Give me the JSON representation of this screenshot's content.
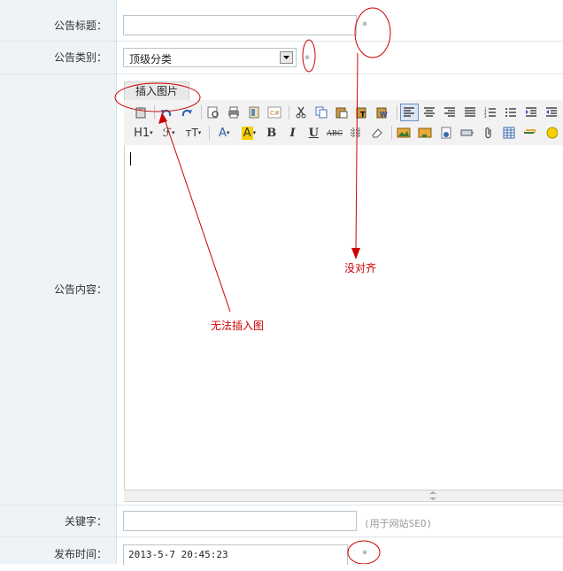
{
  "form": {
    "title_label": "公告标题：",
    "category_label": "公告类别：",
    "category_value": "顶级分类",
    "content_label": "公告内容：",
    "keywords_label": "关键字：",
    "keywords_hint": "(用于网站SEO)",
    "publish_label": "发布时间：",
    "publish_value": "2013-5-7 20:45:23",
    "required_mark": "*"
  },
  "editor": {
    "insert_image_label": "插入图片",
    "heading_label": "H1",
    "font_label": "ℱ",
    "size_label": "тT",
    "color_label": "A",
    "highlight_label": "A",
    "bold_label": "B",
    "italic_label": "I",
    "underline_label": "U",
    "strike_label": "ABC"
  },
  "annotations": {
    "misaligned": "没对齐",
    "cannot_insert": "无法插入图"
  },
  "colors": {
    "label_bg": "#eef3f7",
    "annotation": "#cc0000"
  }
}
